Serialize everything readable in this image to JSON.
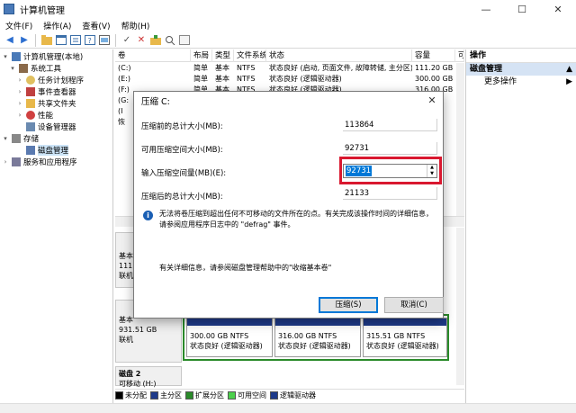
{
  "window": {
    "title": "计算机管理",
    "min": "—",
    "max": "☐",
    "close": "✕"
  },
  "menu": [
    "文件(F)",
    "操作(A)",
    "查看(V)",
    "帮助(H)"
  ],
  "tree": {
    "root": "计算机管理(本地)",
    "system_tools": "系统工具",
    "task_scheduler": "任务计划程序",
    "event_viewer": "事件查看器",
    "shared_folders": "共享文件夹",
    "performance": "性能",
    "device_manager": "设备管理器",
    "storage": "存储",
    "disk_management": "磁盘管理",
    "services": "服务和应用程序"
  },
  "list": {
    "columns": [
      "卷",
      "布局",
      "类型",
      "文件系统",
      "状态",
      "容量",
      "可"
    ],
    "rows": [
      [
        "(C:)",
        "简单",
        "基本",
        "NTFS",
        "状态良好 (启动, 页面文件, 故障转储, 主分区)",
        "111.20 GB",
        "2"
      ],
      [
        "(E:)",
        "简单",
        "基本",
        "NTFS",
        "状态良好 (逻辑驱动器)",
        "300.00 GB",
        "2"
      ],
      [
        "(F:)",
        "简单",
        "基本",
        "NTFS",
        "状态良好 (逻辑驱动器)",
        "316.00 GB",
        "3"
      ],
      [
        "(G:",
        "",
        "",
        "",
        "",
        "",
        ""
      ],
      [
        "(I",
        "",
        "",
        "",
        "",
        "",
        ""
      ],
      [
        "恢",
        "",
        "",
        "",
        "",
        "",
        ""
      ]
    ]
  },
  "disks": {
    "disk0": {
      "l1": "基本",
      "l2": "111.",
      "l3": "联机"
    },
    "disk1": {
      "l1": "基本",
      "l2": "931.51 GB",
      "l3": "联机"
    },
    "disk2": {
      "l1": "磁盘 2",
      "l2": "可移动 (H:)"
    },
    "parts": [
      {
        "size": "300.00 GB NTFS",
        "status": "状态良好 (逻辑驱动器)"
      },
      {
        "size": "316.00 GB NTFS",
        "status": "状态良好 (逻辑驱动器)"
      },
      {
        "size": "315.51 GB NTFS",
        "status": "状态良好 (逻辑驱动器)"
      }
    ]
  },
  "legend": [
    {
      "label": "未分配",
      "color": "#000000"
    },
    {
      "label": "主分区",
      "color": "#1e3a8a"
    },
    {
      "label": "扩展分区",
      "color": "#2a8a2a"
    },
    {
      "label": "可用空间",
      "color": "#4cd04c"
    },
    {
      "label": "逻辑驱动器",
      "color": "#1e3a8a"
    }
  ],
  "actions": {
    "header": "操作",
    "section": "磁盘管理",
    "more": "更多操作"
  },
  "dialog": {
    "title": "压缩 C:",
    "total_before_label": "压缩前的总计大小(MB):",
    "total_before_value": "113864",
    "available_label": "可用压缩空间大小(MB):",
    "available_value": "92731",
    "input_label": "输入压缩空间量(MB)(E):",
    "input_value": "92731",
    "total_after_label": "压缩后的总计大小(MB):",
    "total_after_value": "21133",
    "info_text": "无法将卷压缩到超出任何不可移动的文件所在的点。有关完成该操作时间的详细信息，请参阅应用程序日志中的 \"defrag\" 事件。",
    "help_text": "有关详细信息，请参阅磁盘管理帮助中的\"收缩基本卷\"",
    "ok_label": "压缩(S)",
    "cancel_label": "取消(C)"
  }
}
